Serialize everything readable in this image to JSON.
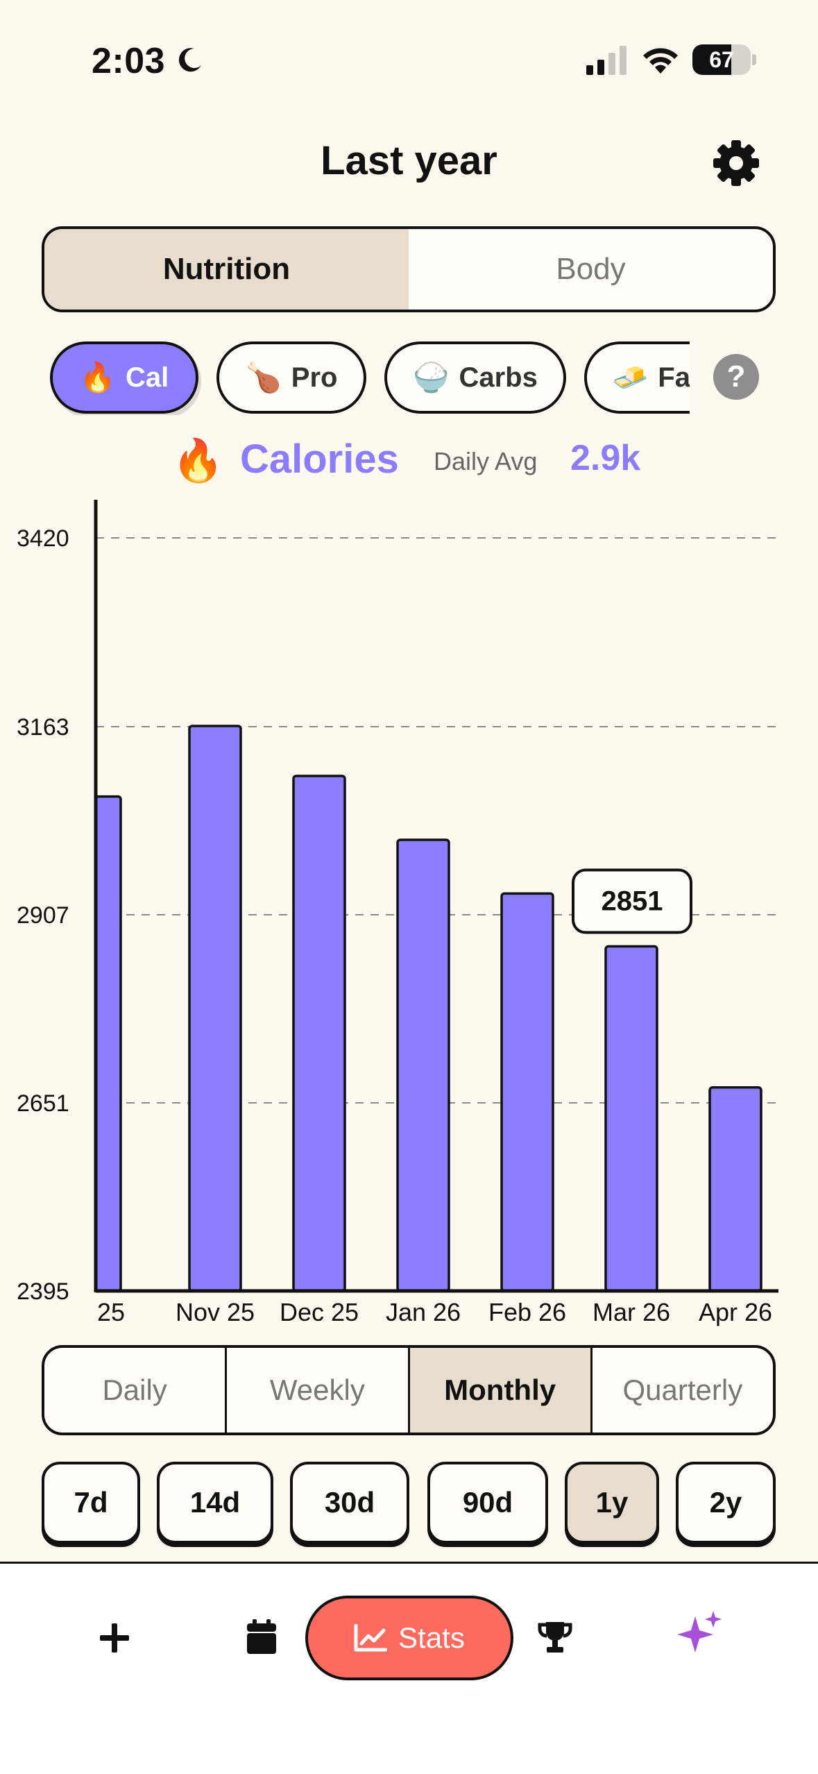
{
  "status_bar": {
    "time": "2:03",
    "battery": "67",
    "battery_level": 0.67
  },
  "header": {
    "title": "Last year"
  },
  "top_tabs": [
    {
      "label": "Nutrition",
      "active": true
    },
    {
      "label": "Body",
      "active": false
    }
  ],
  "metric_chips": [
    {
      "emoji": "🔥",
      "label": "Cal",
      "active": true
    },
    {
      "emoji": "🍗",
      "label": "Pro",
      "active": false
    },
    {
      "emoji": "🍚",
      "label": "Carbs",
      "active": false
    },
    {
      "emoji": "🧈",
      "label": "Fat",
      "active": false
    }
  ],
  "help": {
    "label": "?"
  },
  "metric": {
    "emoji": "🔥",
    "name": "Calories",
    "avg_label": "Daily Avg",
    "avg_value": "2.9k"
  },
  "chart_data": {
    "type": "bar",
    "categories": [
      "25",
      "Nov 25",
      "Dec 25",
      "Jan 26",
      "Feb 26",
      "Mar 26",
      "Apr 26"
    ],
    "values": [
      3068,
      3164,
      3096,
      3009,
      2936,
      2864,
      2672
    ],
    "y_ticks": [
      2395,
      2651,
      2907,
      3163,
      3420
    ],
    "ylim": [
      2395,
      3420
    ],
    "grid": true,
    "tooltip": {
      "category": "Mar 26",
      "label": "2851"
    },
    "bar_color": "#8b7dfb"
  },
  "period_tabs": [
    {
      "label": "Daily",
      "active": false
    },
    {
      "label": "Weekly",
      "active": false
    },
    {
      "label": "Monthly",
      "active": true
    },
    {
      "label": "Quarterly",
      "active": false
    }
  ],
  "range_buttons": [
    {
      "label": "7d",
      "active": false
    },
    {
      "label": "14d",
      "active": false
    },
    {
      "label": "30d",
      "active": false
    },
    {
      "label": "90d",
      "active": false
    },
    {
      "label": "1y",
      "active": true
    },
    {
      "label": "2y",
      "active": false
    }
  ],
  "tab_bar": {
    "add_icon": "plus-icon",
    "calendar_icon": "calendar-icon",
    "stats_label": "Stats",
    "trophy_icon": "trophy-icon",
    "sparkle_icon": "sparkles-icon"
  },
  "colors": {
    "accent": "#8b7dfb",
    "background": "#fdf9ee",
    "active_segment": "#e7dccd",
    "stats_pill": "#fe6a5e",
    "sparkle": "#a64fd8"
  }
}
